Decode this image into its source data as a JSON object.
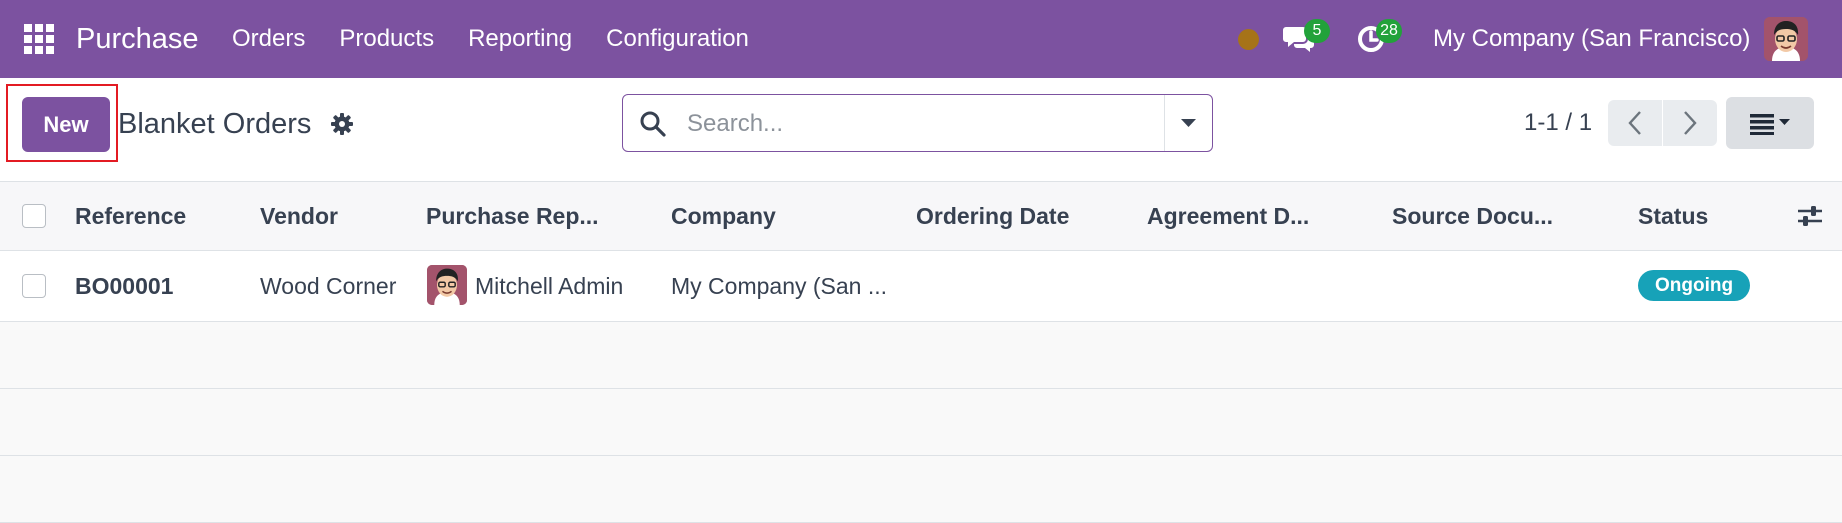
{
  "navbar": {
    "app_name": "Purchase",
    "menu": [
      "Orders",
      "Products",
      "Reporting",
      "Configuration"
    ],
    "messages_count": "5",
    "activities_count": "28",
    "company": "My Company (San Francisco)",
    "colors": {
      "bar": "#7c52a0",
      "badge": "#22a23a",
      "status_dot": "#a67318"
    },
    "icons": [
      "apps-grid-icon",
      "status-dot-icon",
      "chat-icon",
      "activity-clock-icon",
      "user-avatar"
    ]
  },
  "control_panel": {
    "new_label": "New",
    "breadcrumb": "Blanket Orders",
    "search_placeholder": "Search...",
    "pager": "1-1 / 1",
    "icons": [
      "gear-icon",
      "search-icon",
      "caret-down-icon",
      "chevron-left-icon",
      "chevron-right-icon",
      "list-view-icon"
    ]
  },
  "table": {
    "columns": [
      "Reference",
      "Vendor",
      "Purchase Rep...",
      "Company",
      "Ordering Date",
      "Agreement D...",
      "Source Docu...",
      "Status"
    ],
    "rows": [
      {
        "reference": "BO00001",
        "vendor": "Wood Corner",
        "purchase_rep": "Mitchell Admin",
        "company": "My Company (San ...",
        "ordering_date": "",
        "agreement_deadline": "",
        "source_document": "",
        "status": "Ongoing"
      }
    ],
    "status_color": "#17a2b8",
    "icons": [
      "optional-columns-icon"
    ]
  }
}
